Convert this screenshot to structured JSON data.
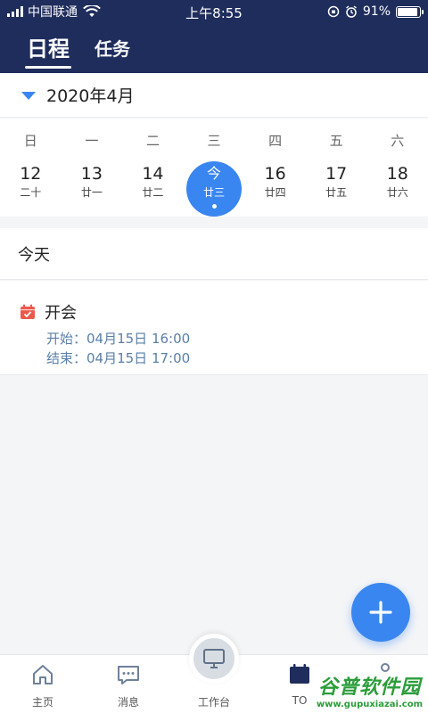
{
  "status_bar": {
    "carrier": "中国联通",
    "time": "上午8:55",
    "battery": "91%",
    "battery_level": 0.91
  },
  "header": {
    "tabs": [
      {
        "label": "日程",
        "active": true
      },
      {
        "label": "任务",
        "active": false
      }
    ]
  },
  "month_selector": {
    "label": "2020年4月"
  },
  "week": {
    "weekdays": [
      "日",
      "一",
      "二",
      "三",
      "四",
      "五",
      "六"
    ],
    "days": [
      {
        "num": "12",
        "lunar": "二十"
      },
      {
        "num": "13",
        "lunar": "廿一"
      },
      {
        "num": "14",
        "lunar": "廿二"
      },
      {
        "num": "今",
        "lunar": "廿三",
        "selected": true
      },
      {
        "num": "16",
        "lunar": "廿四"
      },
      {
        "num": "17",
        "lunar": "廿五"
      },
      {
        "num": "18",
        "lunar": "廿六"
      }
    ]
  },
  "today_section": {
    "label": "今天"
  },
  "events": [
    {
      "title": "开会",
      "start": "开始：04月15日 16:00",
      "end": "结束：04月15日 17:00"
    }
  ],
  "bottom_nav": {
    "items": [
      {
        "label": "主页"
      },
      {
        "label": "消息"
      },
      {
        "label": "工作台"
      },
      {
        "label": "TO"
      },
      {
        "label": ""
      }
    ]
  },
  "watermark": {
    "big": "谷普软件园",
    "small": "www.gupuxiazai.com"
  },
  "colors": {
    "header_bg": "#1f2d5c",
    "accent": "#3a86f0",
    "event_icon": "#ea5a4a"
  }
}
